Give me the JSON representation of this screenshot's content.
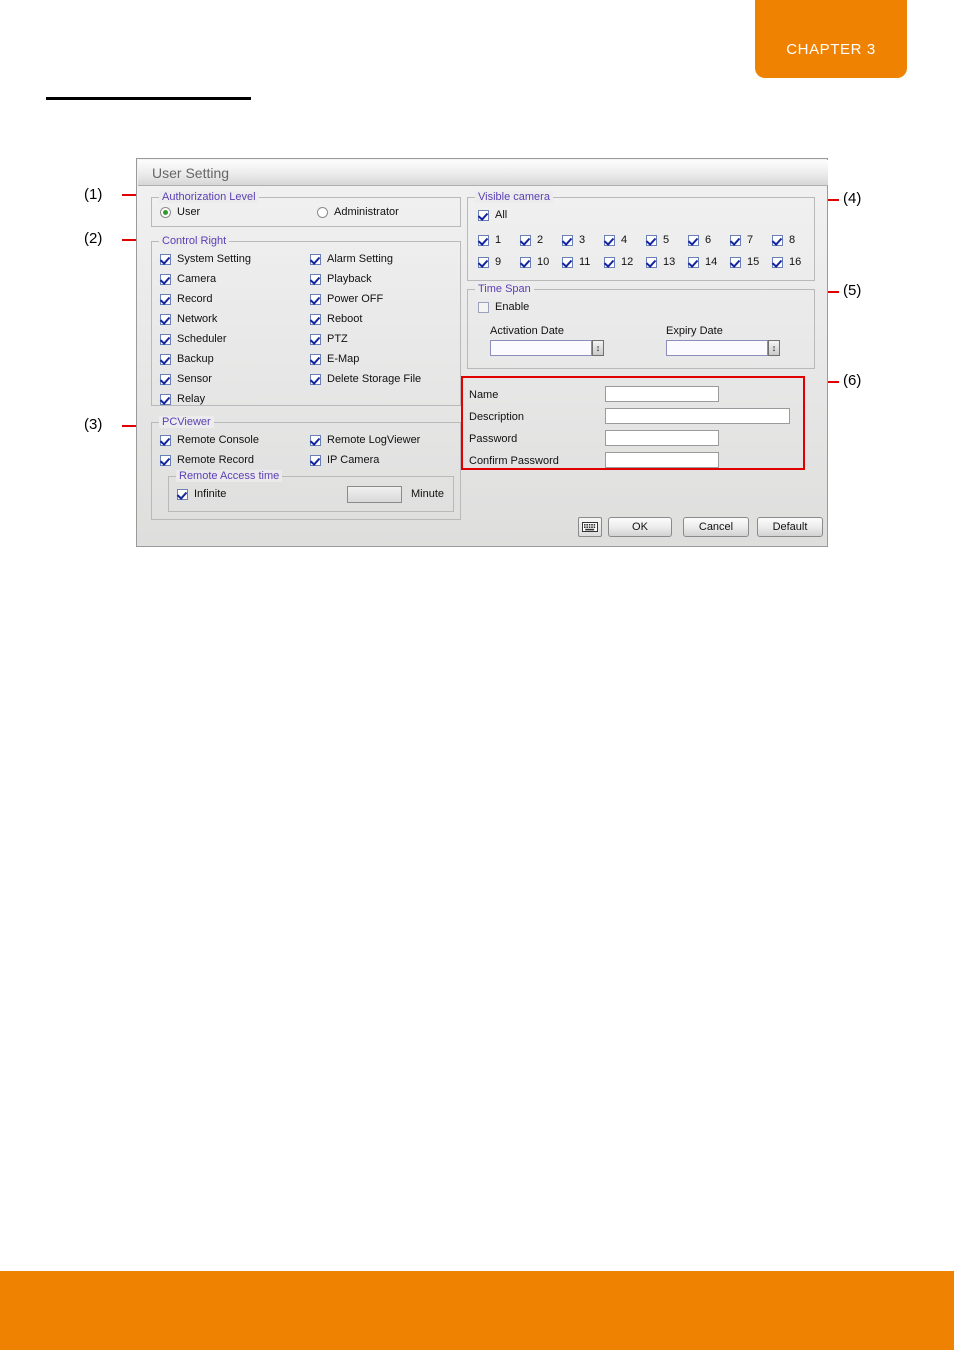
{
  "page": {
    "chapter_tab": "CHAPTER 3"
  },
  "callouts": [
    {
      "id": "1",
      "label": "(1)"
    },
    {
      "id": "2",
      "label": "(2)"
    },
    {
      "id": "3",
      "label": "(3)"
    },
    {
      "id": "4",
      "label": "(4)"
    },
    {
      "id": "5",
      "label": "(5)"
    },
    {
      "id": "6",
      "label": "(6)"
    }
  ],
  "dialog": {
    "title": "User Setting",
    "authorization_level": {
      "group_title": "Authorization Level",
      "options": [
        {
          "label": "User",
          "selected": true
        },
        {
          "label": "Administrator",
          "selected": false
        }
      ]
    },
    "control_right": {
      "group_title": "Control Right",
      "left_column": [
        {
          "label": "System Setting",
          "checked": true
        },
        {
          "label": "Camera",
          "checked": true
        },
        {
          "label": "Record",
          "checked": true
        },
        {
          "label": "Network",
          "checked": true
        },
        {
          "label": "Scheduler",
          "checked": true
        },
        {
          "label": "Backup",
          "checked": true
        },
        {
          "label": "Sensor",
          "checked": true
        },
        {
          "label": "Relay",
          "checked": true
        }
      ],
      "right_column": [
        {
          "label": "Alarm Setting",
          "checked": true
        },
        {
          "label": "Playback",
          "checked": true
        },
        {
          "label": "Power OFF",
          "checked": true
        },
        {
          "label": "Reboot",
          "checked": true
        },
        {
          "label": "PTZ",
          "checked": true
        },
        {
          "label": "E-Map",
          "checked": true
        },
        {
          "label": "Delete Storage File",
          "checked": true
        }
      ]
    },
    "pcviewer": {
      "group_title": "PCViewer",
      "left_column": [
        {
          "label": "Remote Console",
          "checked": true
        },
        {
          "label": "Remote Record",
          "checked": true
        }
      ],
      "right_column": [
        {
          "label": "Remote LogViewer",
          "checked": true
        },
        {
          "label": "IP Camera",
          "checked": true
        }
      ],
      "remote_access_time": {
        "group_title": "Remote Access time",
        "infinite_label": "Infinite",
        "infinite_checked": true,
        "minute_value": "",
        "minute_label": "Minute"
      }
    },
    "visible_camera": {
      "group_title": "Visible camera",
      "all_label": "All",
      "all_checked": true,
      "cameras": [
        {
          "label": "1",
          "checked": true
        },
        {
          "label": "2",
          "checked": true
        },
        {
          "label": "3",
          "checked": true
        },
        {
          "label": "4",
          "checked": true
        },
        {
          "label": "5",
          "checked": true
        },
        {
          "label": "6",
          "checked": true
        },
        {
          "label": "7",
          "checked": true
        },
        {
          "label": "8",
          "checked": true
        },
        {
          "label": "9",
          "checked": true
        },
        {
          "label": "10",
          "checked": true
        },
        {
          "label": "11",
          "checked": true
        },
        {
          "label": "12",
          "checked": true
        },
        {
          "label": "13",
          "checked": true
        },
        {
          "label": "14",
          "checked": true
        },
        {
          "label": "15",
          "checked": true
        },
        {
          "label": "16",
          "checked": true
        }
      ]
    },
    "time_span": {
      "group_title": "Time Span",
      "enable_label": "Enable",
      "enable_checked": false,
      "activation_date_label": "Activation Date",
      "activation_date_value": "",
      "expiry_date_label": "Expiry Date",
      "expiry_date_value": "",
      "spinner_glyph": "↕"
    },
    "account": {
      "name_label": "Name",
      "name_value": "",
      "description_label": "Description",
      "description_value": "",
      "password_label": "Password",
      "password_value": "",
      "confirm_password_label": "Confirm Password",
      "confirm_password_value": ""
    },
    "footer": {
      "keyboard_icon": "keyboard-icon",
      "ok_label": "OK",
      "cancel_label": "Cancel",
      "default_label": "Default"
    }
  },
  "colors": {
    "accent_orange": "#ef8200",
    "callout_red": "#e00000",
    "group_title_purple": "#5b3fb5",
    "checkbox_blue": "#14259b",
    "radio_green": "#2f9b2f"
  }
}
